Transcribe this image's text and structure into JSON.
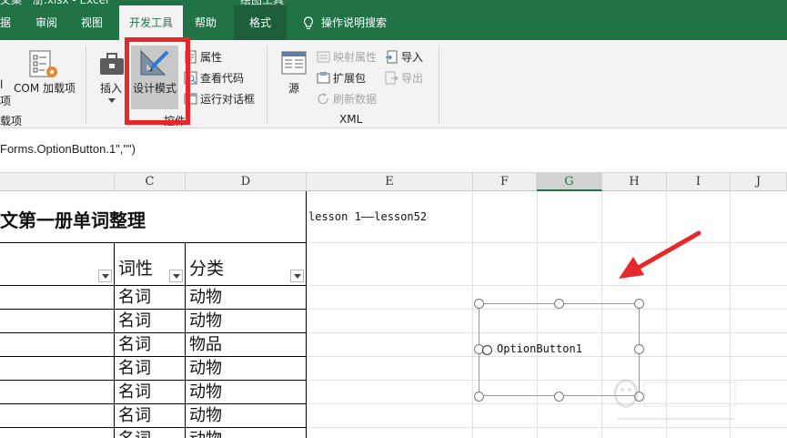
{
  "window": {
    "title_fragment": "文集一册.xlsx - Excel",
    "tool_context": "绘图工具"
  },
  "tabs": [
    {
      "label": "据"
    },
    {
      "label": "审阅"
    },
    {
      "label": "视图"
    },
    {
      "label": "开发工具"
    },
    {
      "label": "帮助"
    },
    {
      "label": "格式"
    },
    {
      "label": "操作说明搜索"
    }
  ],
  "ribbon": {
    "addins": {
      "fragment_top": "l",
      "fragment_bottom": "项",
      "com_label": "COM 加载项",
      "group_fragment": "载项"
    },
    "controls": {
      "insert_label": "插入",
      "design_mode_label": "设计模式",
      "properties_label": "属性",
      "view_code_label": "查看代码",
      "run_dialog_label": "运行对话框",
      "group_label": "控件"
    },
    "xml": {
      "source_label": "源",
      "map_properties_label": "映射属性",
      "expansion_pack_label": "扩展包",
      "refresh_data_label": "刷新数据",
      "import_label": "导入",
      "export_label": "导出",
      "group_label": "XML"
    }
  },
  "formula_bar": {
    "text": "Forms.OptionButton.1\",\"\")"
  },
  "columns": [
    "C",
    "D",
    "E",
    "F",
    "G",
    "H",
    "I",
    "J"
  ],
  "sheet": {
    "title": "文第一册单词整理",
    "note": "lesson 1——lesson52",
    "headers": {
      "pos": "词性",
      "category": "分类"
    },
    "rows": [
      {
        "pos": "名词",
        "category": "动物"
      },
      {
        "pos": "名词",
        "category": "动物"
      },
      {
        "pos": "名词",
        "category": "物品"
      },
      {
        "pos": "名词",
        "category": "动物"
      },
      {
        "pos": "名词",
        "category": "动物"
      },
      {
        "pos": "名词",
        "category": "动物"
      },
      {
        "pos": "名词",
        "category": "动物"
      }
    ]
  },
  "control": {
    "label": "OptionButton1"
  },
  "colors": {
    "excel_green": "#217346",
    "highlight_red": "#e8272a",
    "arrow_red": "#e8272a"
  }
}
